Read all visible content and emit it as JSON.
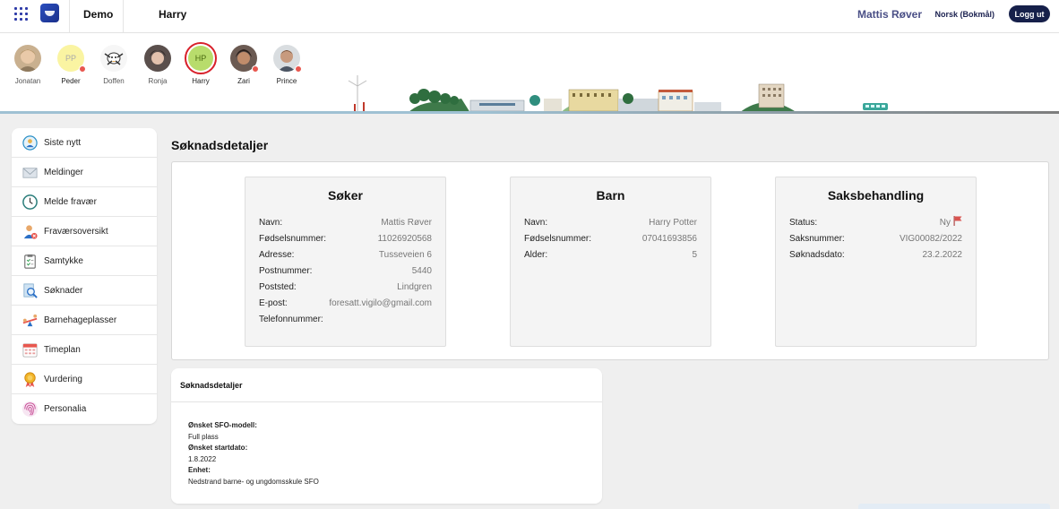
{
  "header": {
    "org": "Demo",
    "child": "Harry",
    "user": "Mattis Røver",
    "language": "Norsk (Bokmål)",
    "logout": "Logg ut"
  },
  "children": [
    {
      "name": "Jonatan",
      "initials": ""
    },
    {
      "name": "Peder",
      "initials": "PP"
    },
    {
      "name": "Doffen",
      "initials": ""
    },
    {
      "name": "Ronja",
      "initials": ""
    },
    {
      "name": "Harry",
      "initials": "HP"
    },
    {
      "name": "Zari",
      "initials": ""
    },
    {
      "name": "Prince",
      "initials": ""
    }
  ],
  "sidebar": {
    "items": [
      {
        "label": "Siste nytt",
        "icon": "news-icon"
      },
      {
        "label": "Meldinger",
        "icon": "envelope-icon"
      },
      {
        "label": "Melde fravær",
        "icon": "clock-icon"
      },
      {
        "label": "Fraværsoversikt",
        "icon": "absence-person-icon"
      },
      {
        "label": "Samtykke",
        "icon": "clipboard-icon"
      },
      {
        "label": "Søknader",
        "icon": "search-document-icon"
      },
      {
        "label": "Barnehageplasser",
        "icon": "seesaw-icon"
      },
      {
        "label": "Timeplan",
        "icon": "calendar-icon"
      },
      {
        "label": "Vurdering",
        "icon": "medal-icon"
      },
      {
        "label": "Personalia",
        "icon": "fingerprint-icon"
      }
    ]
  },
  "page_title": "Søknadsdetaljer",
  "cards": {
    "soker": {
      "title": "Søker",
      "rows": [
        {
          "label": "Navn:",
          "value": "Mattis Røver"
        },
        {
          "label": "Fødselsnummer:",
          "value": "11026920568"
        },
        {
          "label": "Adresse:",
          "value": "Tusseveien 6"
        },
        {
          "label": "Postnummer:",
          "value": "5440"
        },
        {
          "label": "Poststed:",
          "value": "Lindgren"
        },
        {
          "label": "E-post:",
          "value": "foresatt.vigilo@gmail.com"
        },
        {
          "label": "Telefonnummer:",
          "value": ""
        }
      ]
    },
    "barn": {
      "title": "Barn",
      "rows": [
        {
          "label": "Navn:",
          "value": "Harry Potter"
        },
        {
          "label": "Fødselsnummer:",
          "value": "07041693856"
        },
        {
          "label": "Alder:",
          "value": "5"
        }
      ]
    },
    "saks": {
      "title": "Saksbehandling",
      "rows": [
        {
          "label": "Status:",
          "value": "Ny"
        },
        {
          "label": "Saksnummer:",
          "value": "VIG00082/2022"
        },
        {
          "label": "Søknadsdato:",
          "value": "23.2.2022"
        }
      ]
    }
  },
  "details": {
    "title": "Søknadsdetaljer",
    "model_label": "Ønsket SFO-modell:",
    "model_value": "Full plass",
    "start_label": "Ønsket startdato:",
    "start_value": "1.8.2022",
    "unit_label": "Enhet:",
    "unit_value": "Nedstrand barne- og ungdomsskule SFO"
  },
  "colors": {
    "accent": "#16204a",
    "alert": "#e8574f",
    "selected_ring": "#d8202a"
  }
}
